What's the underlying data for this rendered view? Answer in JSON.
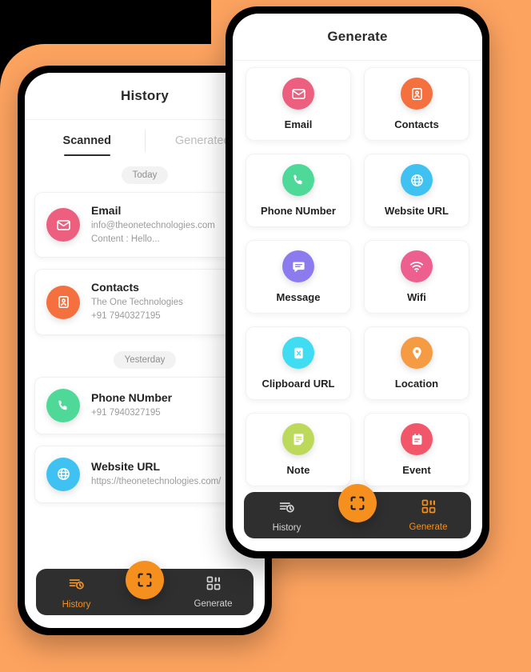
{
  "theme": {
    "background_orange": "#FDA360",
    "accent_orange": "#F5901F",
    "nav_dark": "#2F2F2F"
  },
  "left_phone": {
    "header": {
      "title": "History"
    },
    "tabs": [
      {
        "label": "Scanned",
        "active": true
      },
      {
        "label": "Generated",
        "active": false
      }
    ],
    "sections": [
      {
        "day_label": "Today",
        "items": [
          {
            "title": "Email",
            "lines": [
              "info@theonetechnologies.com",
              "Content : Hello..."
            ],
            "icon": "email-icon",
            "color": "#EC5F7E"
          },
          {
            "title": "Contacts",
            "lines": [
              "The One Technologies",
              "+91 7940327195"
            ],
            "icon": "contacts-icon",
            "color": "#F4703F"
          }
        ]
      },
      {
        "day_label": "Yesterday",
        "items": [
          {
            "title": "Phone NUmber",
            "lines": [
              "+91 7940327195"
            ],
            "icon": "phone-icon",
            "color": "#4ED999"
          },
          {
            "title": "Website URL",
            "lines": [
              "https://theonetechnologies.com/"
            ],
            "icon": "globe-icon",
            "color": "#3FC2F2"
          }
        ]
      }
    ],
    "bottom_nav": {
      "items": [
        {
          "label": "History",
          "icon": "history-icon",
          "active": true
        },
        {
          "label": "Generate",
          "icon": "qr-grid-icon",
          "active": false
        }
      ],
      "fab_icon": "scan-frame-icon"
    }
  },
  "right_phone": {
    "header": {
      "title": "Generate"
    },
    "grid": [
      {
        "label": "Email",
        "icon": "email-icon",
        "color": "#EC5F7E"
      },
      {
        "label": "Contacts",
        "icon": "contacts-icon",
        "color": "#F4703F"
      },
      {
        "label": "Phone NUmber",
        "icon": "phone-icon",
        "color": "#4ED999"
      },
      {
        "label": "Website URL",
        "icon": "globe-icon",
        "color": "#3FC2F2"
      },
      {
        "label": "Message",
        "icon": "message-icon",
        "color": "#8B7BEE"
      },
      {
        "label": "Wifi",
        "icon": "wifi-icon",
        "color": "#EC5F8E"
      },
      {
        "label": "Clipboard URL",
        "icon": "clipboard-icon",
        "color": "#3FDCF2"
      },
      {
        "label": "Location",
        "icon": "location-pin-icon",
        "color": "#F59B43"
      },
      {
        "label": "Note",
        "icon": "note-icon",
        "color": "#BDD95C"
      },
      {
        "label": "Event",
        "icon": "calendar-icon",
        "color": "#F2566B"
      }
    ],
    "bottom_nav": {
      "items": [
        {
          "label": "History",
          "icon": "history-icon",
          "active": false
        },
        {
          "label": "Generate",
          "icon": "qr-grid-icon",
          "active": true
        }
      ],
      "fab_icon": "scan-frame-icon"
    }
  }
}
